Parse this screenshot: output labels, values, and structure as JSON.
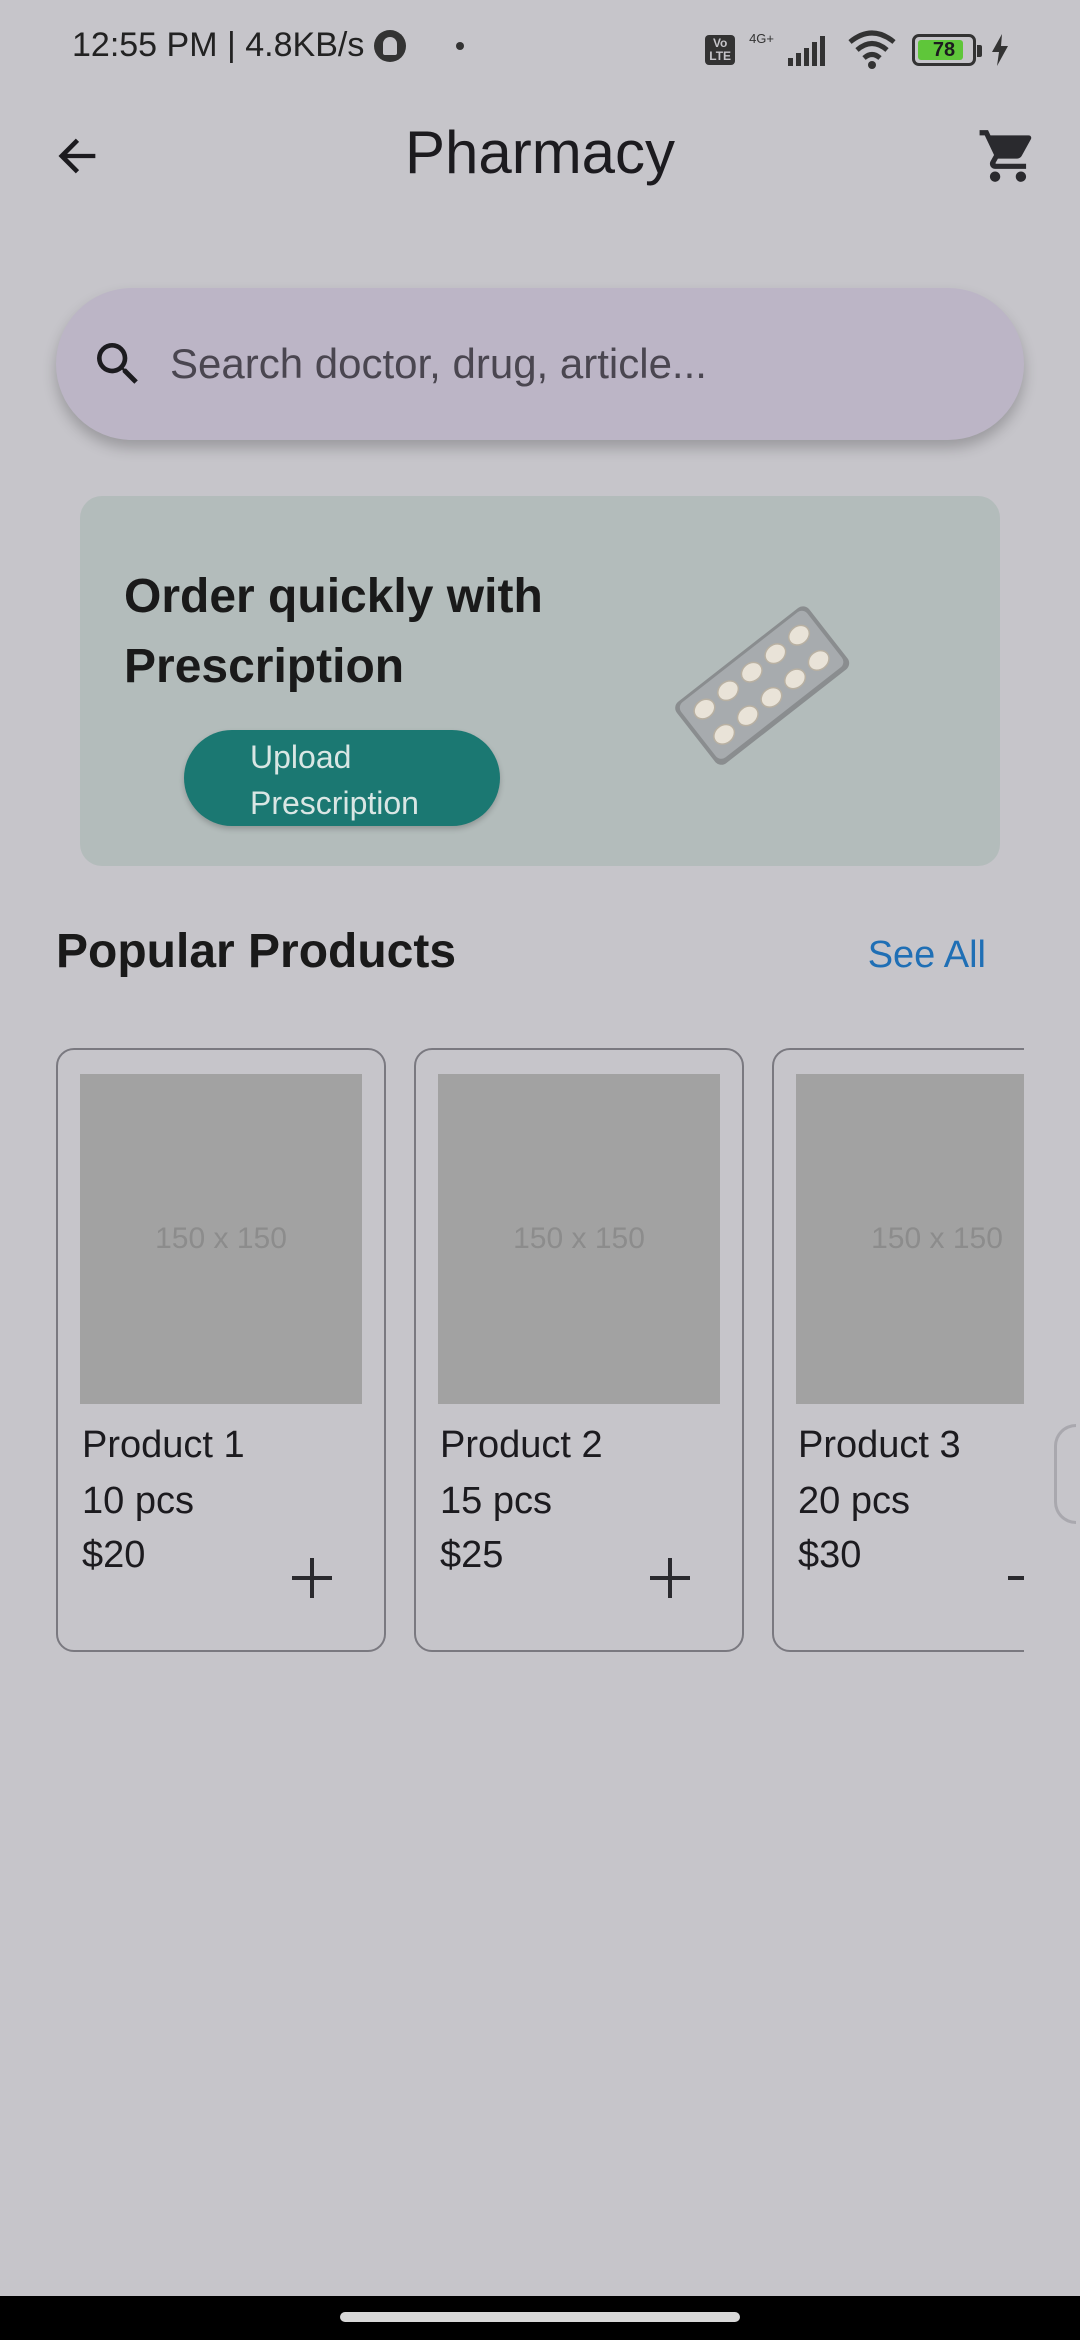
{
  "status_bar": {
    "time_speed": "12:55 PM | 4.8KB/s",
    "volte": "Vo\nLTE",
    "network": "4G+",
    "battery": "78"
  },
  "app_bar": {
    "title": "Pharmacy"
  },
  "search": {
    "placeholder": "Search doctor, drug, article..."
  },
  "promo": {
    "title": "Order quickly with Prescription",
    "button_label": "Upload Prescription"
  },
  "section": {
    "title": "Popular Products",
    "see_all": "See All"
  },
  "products": [
    {
      "image_label": "150 x 150",
      "name": "Product 1",
      "qty": "10 pcs",
      "price": "$20"
    },
    {
      "image_label": "150 x 150",
      "name": "Product 2",
      "qty": "15 pcs",
      "price": "$25"
    },
    {
      "image_label": "150 x 150",
      "name": "Product 3",
      "qty": "20 pcs",
      "price": "$30"
    }
  ],
  "colors": {
    "background": "#c6c5ca",
    "search_bg": "#bcb5c6",
    "banner_bg": "#b3bcbb",
    "accent_button": "#1b7872",
    "link": "#1f6fb5",
    "battery": "#5fc63a"
  },
  "icons": {
    "back": "arrow-left-icon",
    "cart": "shopping-cart-icon",
    "search": "magnifier-icon",
    "add": "plus-icon",
    "pill": "pill-blister-icon"
  }
}
